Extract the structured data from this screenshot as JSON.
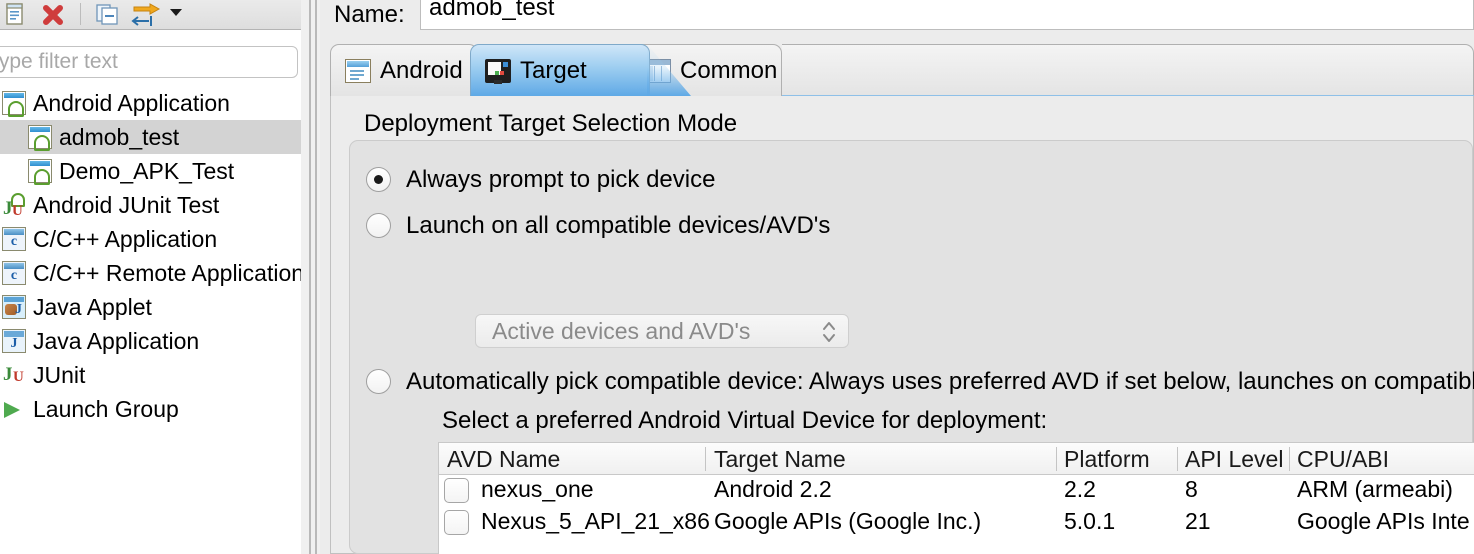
{
  "toolbar": {
    "icons": [
      {
        "name": "duplicate-icon",
        "label": "Duplicate"
      },
      {
        "name": "delete-icon",
        "label": "Delete"
      },
      {
        "name": "collapse-all-icon",
        "label": "Collapse All"
      },
      {
        "name": "filter-icon",
        "label": "Filter"
      },
      {
        "name": "chevron-down-icon",
        "label": "Menu"
      }
    ]
  },
  "filter": {
    "placeholder": "type filter text",
    "value": ""
  },
  "tree": {
    "items": [
      {
        "label": "Android Application",
        "icon": "android-application-icon",
        "indent": 0,
        "selected": false
      },
      {
        "label": "admob_test",
        "icon": "android-application-icon",
        "indent": 1,
        "selected": true
      },
      {
        "label": "Demo_APK_Test",
        "icon": "android-application-icon",
        "indent": 1,
        "selected": false
      },
      {
        "label": "Android JUnit Test",
        "icon": "android-junit-icon",
        "indent": 0,
        "selected": false
      },
      {
        "label": "C/C++ Application",
        "icon": "cpp-application-icon",
        "indent": 0,
        "selected": false
      },
      {
        "label": "C/C++ Remote Application",
        "icon": "cpp-remote-icon",
        "indent": 0,
        "selected": false
      },
      {
        "label": "Java Applet",
        "icon": "java-applet-icon",
        "indent": 0,
        "selected": false
      },
      {
        "label": "Java Application",
        "icon": "java-application-icon",
        "indent": 0,
        "selected": false
      },
      {
        "label": "JUnit",
        "icon": "junit-icon",
        "indent": 0,
        "selected": false
      },
      {
        "label": "Launch Group",
        "icon": "launch-group-icon",
        "indent": 0,
        "selected": false
      }
    ]
  },
  "name_field": {
    "label": "Name:",
    "value": "admob_test"
  },
  "tabs": [
    {
      "label": "Android",
      "icon": "android-doc-icon",
      "active": false
    },
    {
      "label": "Target",
      "icon": "monitor-icon",
      "active": true
    },
    {
      "label": "Common",
      "icon": "table-icon",
      "active": false
    }
  ],
  "section": {
    "title": "Deployment Target Selection Mode"
  },
  "radios": [
    {
      "label": "Always prompt to pick device",
      "checked": true
    },
    {
      "label": "Launch on all compatible devices/AVD's",
      "checked": false
    },
    {
      "label": "Automatically pick compatible device: Always uses preferred AVD if set below, launches on compatible",
      "checked": false
    }
  ],
  "combo": {
    "value": "Active devices and AVD's",
    "arrow_glyph": "⌃⌄"
  },
  "avd_prompt": "Select a preferred Android Virtual Device for deployment:",
  "avd_table": {
    "columns": [
      "AVD Name",
      "Target Name",
      "Platform",
      "API Level",
      "CPU/ABI"
    ],
    "rows": [
      {
        "checked": false,
        "avd_name": "nexus_one",
        "target_name": "Android 2.2",
        "platform": "2.2",
        "api_level": "8",
        "cpu_abi": "ARM (armeabi)"
      },
      {
        "checked": false,
        "avd_name": "Nexus_5_API_21_x86",
        "target_name": "Google APIs (Google Inc.)",
        "platform": "5.0.1",
        "api_level": "21",
        "cpu_abi": "Google APIs Inte"
      }
    ]
  },
  "colors": {
    "accent": "#5fa9e6",
    "selection": "#d3d3d3",
    "panel_bg": "#ececec",
    "group_bg": "#e2e2e2"
  }
}
